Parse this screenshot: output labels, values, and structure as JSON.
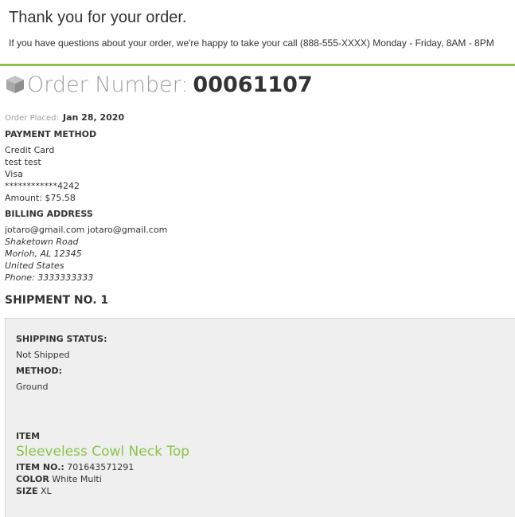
{
  "header": {
    "thanks": "Thank you for your order.",
    "questions": "If you have questions about your order, we're happy to take your call (888-555-XXXX) Monday - Friday, 8AM - 8PM",
    "accent_color": "#8bc34a"
  },
  "order": {
    "icon": "box-icon",
    "label": "Order Number:",
    "number": "00061107",
    "placed_label": "Order Placed:",
    "placed_date": "Jan 28, 2020"
  },
  "payment": {
    "title": "PAYMENT METHOD",
    "type": "Credit Card",
    "name": "test test",
    "brand": "Visa",
    "card": "************4242",
    "amount": "Amount: $75.58"
  },
  "billing": {
    "title": "BILLING ADDRESS",
    "name": "jotaro@gmail.com jotaro@gmail.com",
    "street": "Shaketown Road",
    "city": "Morioh, AL 12345",
    "country": "United States",
    "phone": "Phone: 3333333333"
  },
  "shipment": {
    "title": "SHIPMENT NO. 1",
    "status_label": "SHIPPING STATUS:",
    "status": "Not Shipped",
    "method_label": "METHOD:",
    "method": "Ground",
    "item_label": "ITEM",
    "item_name": "Sleeveless Cowl Neck Top",
    "item_no_label": "ITEM NO.:",
    "item_no": "701643571291",
    "color_label": "COLOR",
    "color": "White Multi",
    "size_label": "SIZE",
    "size": "XL"
  }
}
